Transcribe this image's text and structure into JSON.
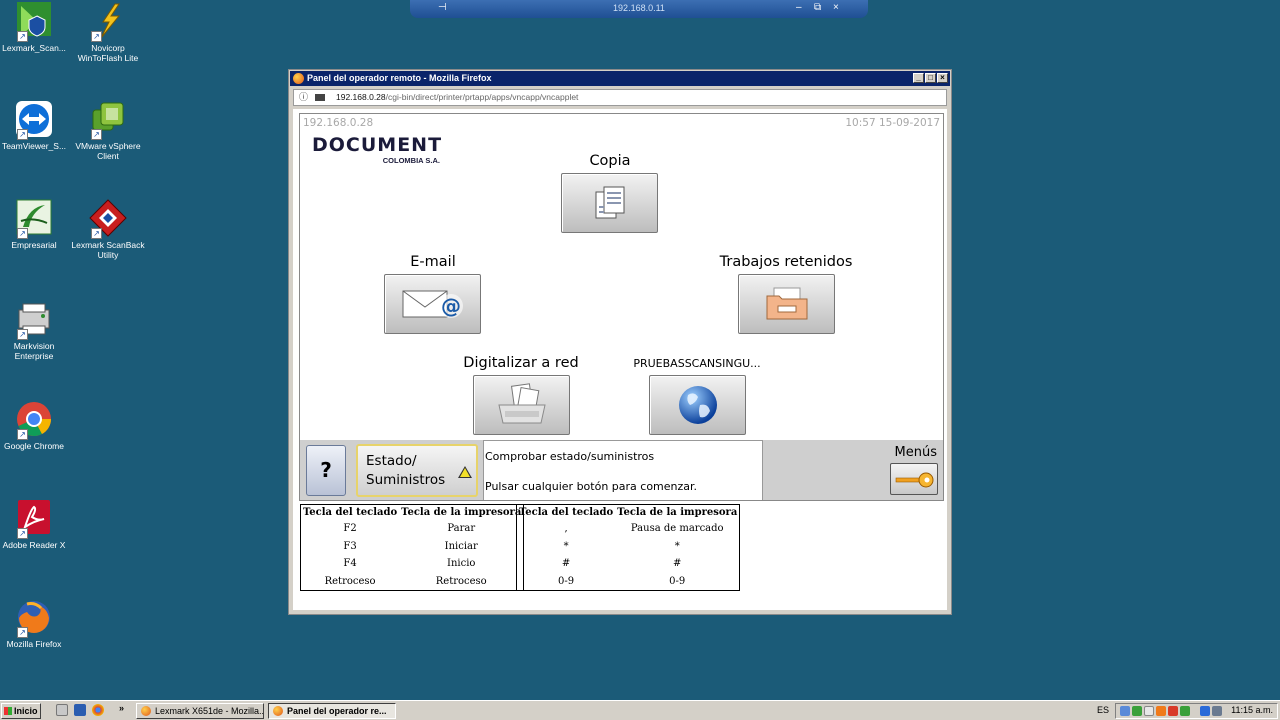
{
  "desktop": {
    "icons": [
      {
        "label": "Lexmark_Scan..."
      },
      {
        "label": "Novicorp WinToFlash Lite"
      },
      {
        "label": "TeamViewer_S..."
      },
      {
        "label": "VMware vSphere Client"
      },
      {
        "label": "Empresarial"
      },
      {
        "label": "Lexmark ScanBack Utility"
      },
      {
        "label": "Markvision Enterprise"
      },
      {
        "label": "Google Chrome"
      },
      {
        "label": "Adobe Reader X"
      },
      {
        "label": "Mozilla Firefox"
      }
    ]
  },
  "remote_bar": {
    "host": "192.168.0.11",
    "pin_icon": "pin-icon",
    "minimize": "–",
    "restore": "⧉",
    "close": "×"
  },
  "window": {
    "title": "Panel del operador remoto - Mozilla Firefox",
    "url_host": "192.168.0.28",
    "url_path": "/cgi-bin/direct/printer/prtapp/apps/vncapp/vncapplet"
  },
  "panel": {
    "ip": "192.168.0.28",
    "datetime": "10:57 15-09-2017",
    "logo_main": "DOCUMENT",
    "logo_sub": "COLOMBIA S.A.",
    "functions": {
      "copia": "Copia",
      "email": "E-mail",
      "trabajos": "Trabajos retenidos",
      "digitalizar": "Digitalizar a red",
      "prueba": "PRUEBASSCANSINGU..."
    },
    "help_label": "?",
    "estado_line1": "Estado/",
    "estado_line2": "Suministros",
    "message_line1": "Comprobar estado/suministros",
    "message_line2": "Pulsar cualquier botón para comenzar.",
    "menus_label": "Menús"
  },
  "keyboard_tables": [
    {
      "headers": [
        "Tecla del teclado",
        "Tecla de la impresora"
      ],
      "rows": [
        [
          "F2",
          "Parar"
        ],
        [
          "F3",
          "Iniciar"
        ],
        [
          "F4",
          "Inicio"
        ],
        [
          "Retroceso",
          "Retroceso"
        ]
      ]
    },
    {
      "headers": [
        "Tecla del teclado",
        "Tecla de la impresora"
      ],
      "rows": [
        [
          ",",
          "Pausa de marcado"
        ],
        [
          "*",
          "*"
        ],
        [
          "#",
          "#"
        ],
        [
          "0-9",
          "0-9"
        ]
      ]
    }
  ],
  "taskbar": {
    "start": "Inicio",
    "chevron": "»",
    "tasks": [
      {
        "label": "Lexmark X651de - Mozilla..."
      },
      {
        "label": "Panel del operador re..."
      }
    ],
    "language": "ES",
    "clock": "11:15 a.m."
  }
}
